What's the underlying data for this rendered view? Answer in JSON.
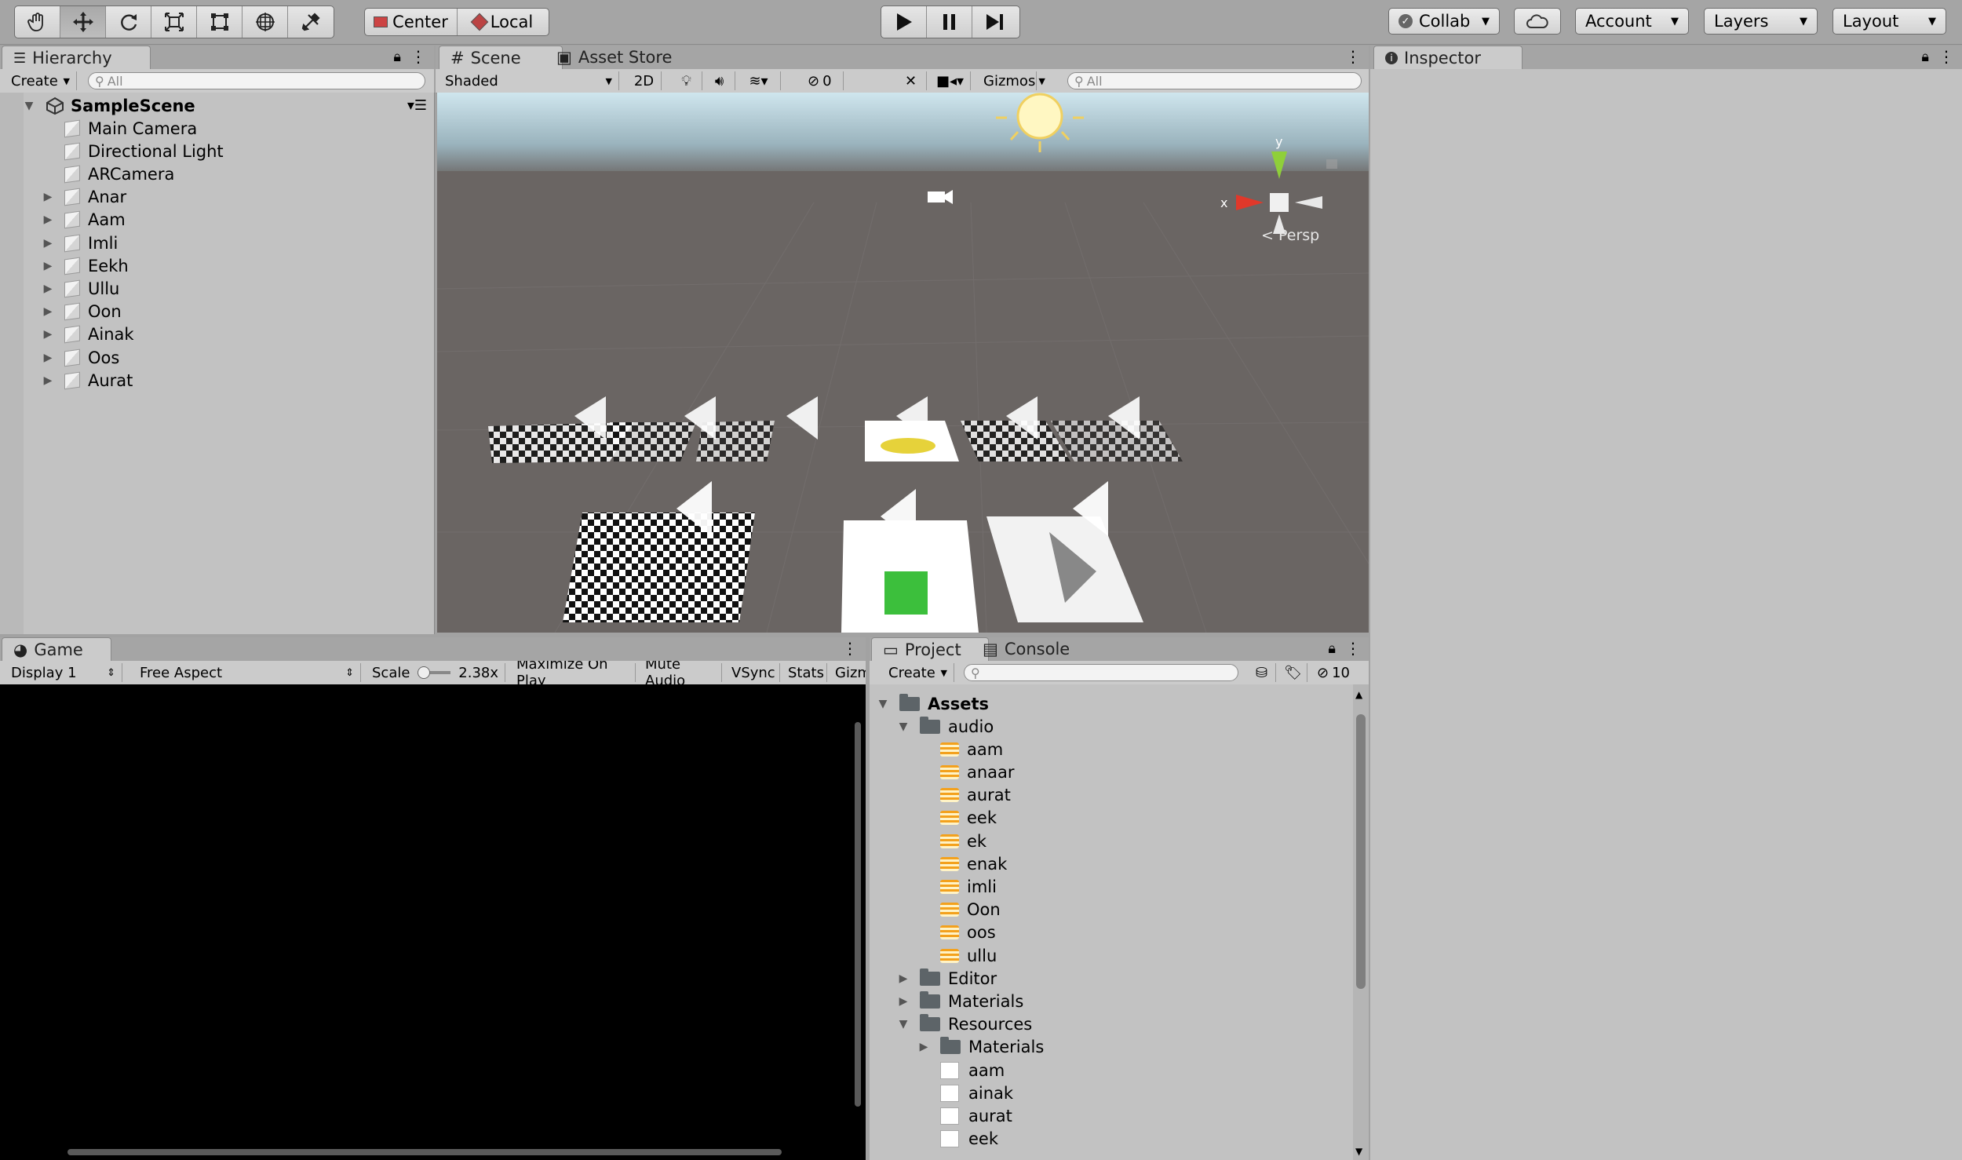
{
  "toolbar": {
    "transform_tools": [
      "hand-tool",
      "move-tool",
      "rotate-tool",
      "scale-tool",
      "rect-tool",
      "transform-tool",
      "custom-tool"
    ],
    "pivot_center": "Center",
    "pivot_local": "Local",
    "collab": "Collab",
    "account": "Account",
    "layers": "Layers",
    "layout": "Layout"
  },
  "hierarchy": {
    "tab": "Hierarchy",
    "create": "Create",
    "search_placeholder": "All",
    "scene": "SampleScene",
    "items": [
      {
        "label": "Main Camera",
        "expandable": false
      },
      {
        "label": "Directional Light",
        "expandable": false
      },
      {
        "label": "ARCamera",
        "expandable": false
      },
      {
        "label": "Anar",
        "expandable": true
      },
      {
        "label": "Aam",
        "expandable": true
      },
      {
        "label": "Imli",
        "expandable": true
      },
      {
        "label": "Eekh",
        "expandable": true
      },
      {
        "label": "Ullu",
        "expandable": true
      },
      {
        "label": "Oon",
        "expandable": true
      },
      {
        "label": "Ainak",
        "expandable": true
      },
      {
        "label": "Oos",
        "expandable": true
      },
      {
        "label": "Aurat",
        "expandable": true
      }
    ]
  },
  "scene": {
    "tab_scene": "Scene",
    "tab_asset_store": "Asset Store",
    "shading": "Shaded",
    "mode_2d": "2D",
    "hidden_count": "0",
    "gizmos": "Gizmos",
    "search_placeholder": "All",
    "persp_label": "Persp",
    "axis_y": "y",
    "axis_x": "x"
  },
  "inspector": {
    "tab": "Inspector"
  },
  "game": {
    "tab": "Game",
    "display": "Display 1",
    "aspect": "Free Aspect",
    "scale_label": "Scale",
    "scale_value": "2.38x",
    "maximize": "Maximize On Play",
    "mute": "Mute Audio",
    "vsync": "VSync",
    "stats": "Stats",
    "gizmos": "Gizm"
  },
  "project": {
    "tab_project": "Project",
    "tab_console": "Console",
    "create": "Create",
    "hidden_count": "10",
    "assets_label": "Assets",
    "tree": [
      {
        "label": "audio",
        "level": 1,
        "kind": "folder",
        "state": "open"
      },
      {
        "label": "aam",
        "level": 2,
        "kind": "audio"
      },
      {
        "label": "anaar",
        "level": 2,
        "kind": "audio"
      },
      {
        "label": "aurat",
        "level": 2,
        "kind": "audio"
      },
      {
        "label": "eek",
        "level": 2,
        "kind": "audio"
      },
      {
        "label": "ek",
        "level": 2,
        "kind": "audio"
      },
      {
        "label": "enak",
        "level": 2,
        "kind": "audio"
      },
      {
        "label": "imli",
        "level": 2,
        "kind": "audio"
      },
      {
        "label": "Oon",
        "level": 2,
        "kind": "audio"
      },
      {
        "label": "oos",
        "level": 2,
        "kind": "audio"
      },
      {
        "label": "ullu",
        "level": 2,
        "kind": "audio"
      },
      {
        "label": "Editor",
        "level": 1,
        "kind": "folder",
        "state": "closed"
      },
      {
        "label": "Materials",
        "level": 1,
        "kind": "folder",
        "state": "closed"
      },
      {
        "label": "Resources",
        "level": 1,
        "kind": "folder",
        "state": "open"
      },
      {
        "label": "Materials",
        "level": 2,
        "kind": "folder",
        "state": "closed"
      },
      {
        "label": "aam",
        "level": 2,
        "kind": "image"
      },
      {
        "label": "ainak",
        "level": 2,
        "kind": "image"
      },
      {
        "label": "aurat",
        "level": 2,
        "kind": "image"
      },
      {
        "label": "eek",
        "level": 2,
        "kind": "image"
      }
    ]
  },
  "colors": {
    "chrome": "#a5a5a5",
    "panel": "#c2c2c2",
    "scene_ground": "#6a6563",
    "accent_axis_x": "#e0382a",
    "accent_axis_y": "#8fcf3a",
    "audio_icon": "#f3a11d"
  }
}
